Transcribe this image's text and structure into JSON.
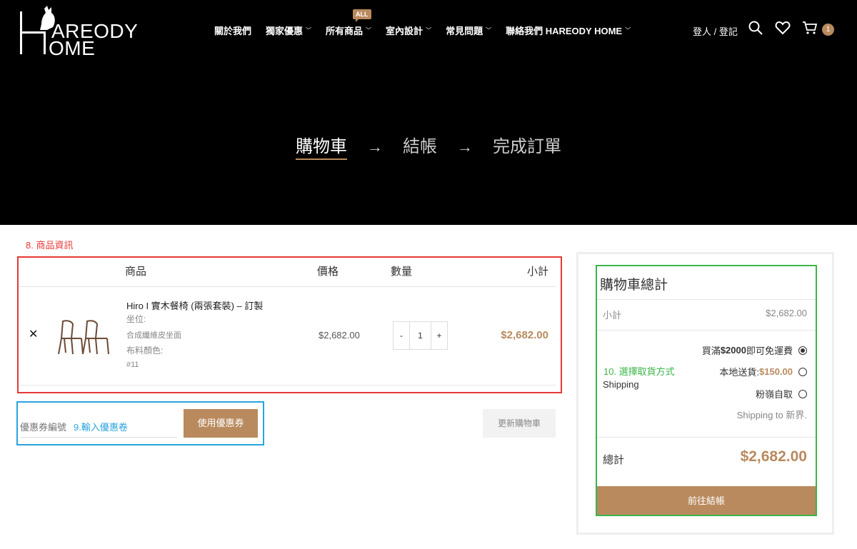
{
  "header": {
    "logo_line1": "AREODY",
    "logo_line2": "OME",
    "nav": [
      {
        "label": "關於我們",
        "has_dropdown": false
      },
      {
        "label": "獨家優惠",
        "has_dropdown": true
      },
      {
        "label": "所有商品",
        "has_dropdown": true,
        "badge": "ALL"
      },
      {
        "label": "室內設計",
        "has_dropdown": true
      },
      {
        "label": "常見問題",
        "has_dropdown": true
      },
      {
        "label": "聯絡我們 HAREODY HOME",
        "has_dropdown": true
      }
    ],
    "login_label": "登人 / 登記",
    "cart_count": "1"
  },
  "steps": {
    "cart": "購物車",
    "checkout": "結帳",
    "complete": "完成訂單",
    "arrow": "→"
  },
  "annotations": {
    "product_info": "8. 商品資訊",
    "coupon": "9.輸入優惠卷",
    "shipping": "10. 選擇取貨方式"
  },
  "cart_table": {
    "headers": {
      "product": "商品",
      "price": "價格",
      "qty": "數量",
      "subtotal": "小計"
    },
    "item": {
      "remove": "✕",
      "name": "Hiro I 實木餐椅 (兩張套裝) – 訂製",
      "meta_seat_label": "坐位:",
      "meta_seat_value": "合成纖維皮坐面",
      "meta_color_label": "布料顏色:",
      "meta_color_value": "#11",
      "price": "$2,682.00",
      "qty": "1",
      "minus": "-",
      "plus": "+",
      "subtotal": "$2,682.00"
    }
  },
  "coupon": {
    "placeholder": "優惠券編號",
    "apply_label": "使用優惠券",
    "update_label": "更新購物車"
  },
  "totals": {
    "title": "購物車總計",
    "subtotal_label": "小計",
    "subtotal_value": "$2,682.00",
    "shipping_label": "Shipping",
    "options": [
      {
        "label_prefix": "買滿",
        "bold_amount": "$2000",
        "label_suffix": " 即可免運費",
        "selected": true
      },
      {
        "label_prefix": "本地送貨: ",
        "price": "$150.00",
        "selected": false
      },
      {
        "label_prefix": "粉嶺自取",
        "selected": false
      }
    ],
    "shipping_to": "Shipping to 新界.",
    "total_label": "總計",
    "total_value": "$2,682.00",
    "checkout_label": "前往結帳"
  },
  "colors": {
    "accent": "#b98a5e",
    "annotation_red": "#e53935",
    "annotation_blue": "#29a3dd",
    "annotation_green": "#3cb54a"
  }
}
